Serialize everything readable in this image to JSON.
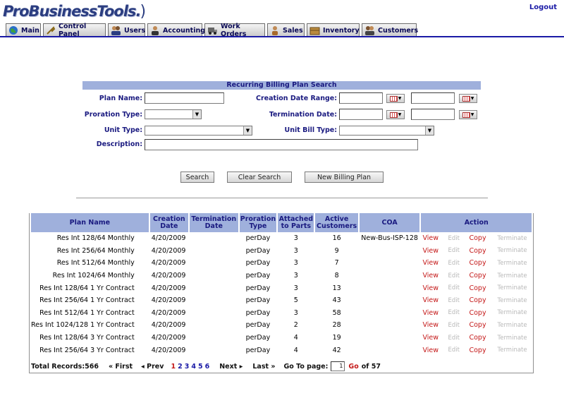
{
  "app": {
    "logo": "ProBusinessTools.",
    "logout": "Logout"
  },
  "tabs": [
    {
      "label": "Main",
      "icon": "globe-icon"
    },
    {
      "label": "Control Panel",
      "icon": "wrench-icon"
    },
    {
      "label": "Users",
      "icon": "users-icon"
    },
    {
      "label": "Accounting",
      "icon": "accountant-icon"
    },
    {
      "label": "Work Orders",
      "icon": "truck-icon"
    },
    {
      "label": "Sales",
      "icon": "handshake-icon"
    },
    {
      "label": "Inventory",
      "icon": "box-icon"
    },
    {
      "label": "Customers",
      "icon": "customers-icon"
    }
  ],
  "search": {
    "title": "Recurring Billing Plan Search",
    "plan_name_label": "Plan Name:",
    "plan_name_value": "",
    "creation_date_label": "Creation Date Range:",
    "proration_type_label": "Proration Type:",
    "proration_type_value": "",
    "termination_date_label": "Termination Date:",
    "unit_type_label": "Unit Type:",
    "unit_type_value": "",
    "unit_bill_type_label": "Unit Bill Type:",
    "unit_bill_type_value": "",
    "description_label": "Description:",
    "description_value": "",
    "search_button": "Search",
    "clear_button": "Clear Search",
    "new_plan_button": "New Billing Plan"
  },
  "table": {
    "headers": {
      "plan_name": "Plan Name",
      "creation_1": "Creation",
      "creation_2": "Date",
      "termination_1": "Termination",
      "termination_2": "Date",
      "proration_1": "Proration",
      "proration_2": "Type",
      "attached_1": "Attached",
      "attached_2": "to Parts",
      "active_1": "Active",
      "active_2": "Customers",
      "coa": "COA",
      "action": "Action"
    },
    "action_labels": {
      "view": "View",
      "edit": "Edit",
      "copy": "Copy",
      "terminate": "Terminate"
    },
    "rows": [
      {
        "name": "Res Int 128/64 Monthly",
        "created": "4/20/2009",
        "terminated": "",
        "proration": "perDay",
        "attached": "3",
        "active": "16",
        "coa": "New-Bus-ISP-128"
      },
      {
        "name": "Res Int 256/64 Monthly",
        "created": "4/20/2009",
        "terminated": "",
        "proration": "perDay",
        "attached": "3",
        "active": "9",
        "coa": ""
      },
      {
        "name": "Res Int 512/64 Monthly",
        "created": "4/20/2009",
        "terminated": "",
        "proration": "perDay",
        "attached": "3",
        "active": "7",
        "coa": ""
      },
      {
        "name": "Res Int 1024/64 Monthly",
        "created": "4/20/2009",
        "terminated": "",
        "proration": "perDay",
        "attached": "3",
        "active": "8",
        "coa": ""
      },
      {
        "name": "Res Int 128/64 1 Yr Contract",
        "created": "4/20/2009",
        "terminated": "",
        "proration": "perDay",
        "attached": "3",
        "active": "13",
        "coa": ""
      },
      {
        "name": "Res Int 256/64 1 Yr Contract",
        "created": "4/20/2009",
        "terminated": "",
        "proration": "perDay",
        "attached": "5",
        "active": "43",
        "coa": ""
      },
      {
        "name": "Res Int 512/64 1 Yr Contract",
        "created": "4/20/2009",
        "terminated": "",
        "proration": "perDay",
        "attached": "3",
        "active": "58",
        "coa": ""
      },
      {
        "name": "Res Int 1024/128 1 Yr Contract",
        "created": "4/20/2009",
        "terminated": "",
        "proration": "perDay",
        "attached": "2",
        "active": "28",
        "coa": ""
      },
      {
        "name": "Res Int 128/64 3 Yr Contract",
        "created": "4/20/2009",
        "terminated": "",
        "proration": "perDay",
        "attached": "4",
        "active": "19",
        "coa": ""
      },
      {
        "name": "Res Int 256/64 3 Yr Contract",
        "created": "4/20/2009",
        "terminated": "",
        "proration": "perDay",
        "attached": "4",
        "active": "42",
        "coa": ""
      }
    ]
  },
  "pager": {
    "total": "Total Records:566",
    "first": "First",
    "prev": "Prev",
    "pages": [
      "1",
      "2",
      "3",
      "4",
      "5",
      "6"
    ],
    "current_page": "1",
    "next": "Next",
    "last": "Last",
    "goto_label": "Go To page:",
    "goto_value": "1",
    "go": "Go",
    "of_total": "of 57"
  },
  "colors": {
    "header_blue": "#9fb0dc",
    "label_navy": "#1a1a80",
    "action_red": "#c41818",
    "tab_line": "#1a1aa6"
  }
}
